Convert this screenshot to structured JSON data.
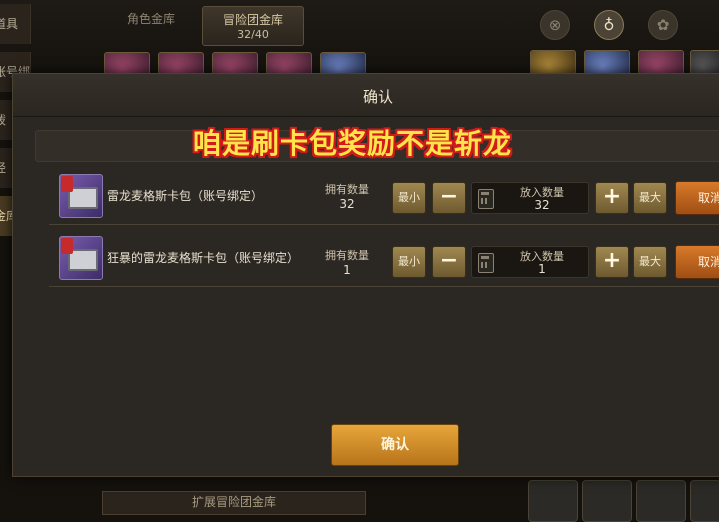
{
  "background": {
    "left_menu": [
      "道具",
      "账号绑定",
      "拨",
      "经",
      "金库"
    ],
    "tabs": [
      {
        "label": "角色金库",
        "count": ""
      },
      {
        "label": "冒险团金库",
        "count": "32/40"
      }
    ],
    "bottom_tab_label": "扩展冒险团金库"
  },
  "dialog": {
    "title": "确认",
    "overlay_caption": "咱是刷卡包奖励不是斩龙",
    "own_label": "拥有数量",
    "put_label": "放入数量",
    "min_label": "最小",
    "max_label": "最大",
    "minus_symbol": "−",
    "plus_symbol": "+",
    "cancel_label": "取消",
    "items": [
      {
        "name": "雷龙麦格斯卡包（账号绑定）",
        "owned": "32",
        "put": "32"
      },
      {
        "name": "狂暴的雷龙麦格斯卡包（账号绑定）",
        "owned": "1",
        "put": "1"
      }
    ],
    "confirm_label": "确认"
  },
  "colors": {
    "accent_gold": "#e7a63b",
    "cancel_orange": "#d77a2a",
    "caption_yellow": "#ffe44a",
    "caption_outline": "#d21a1a"
  }
}
